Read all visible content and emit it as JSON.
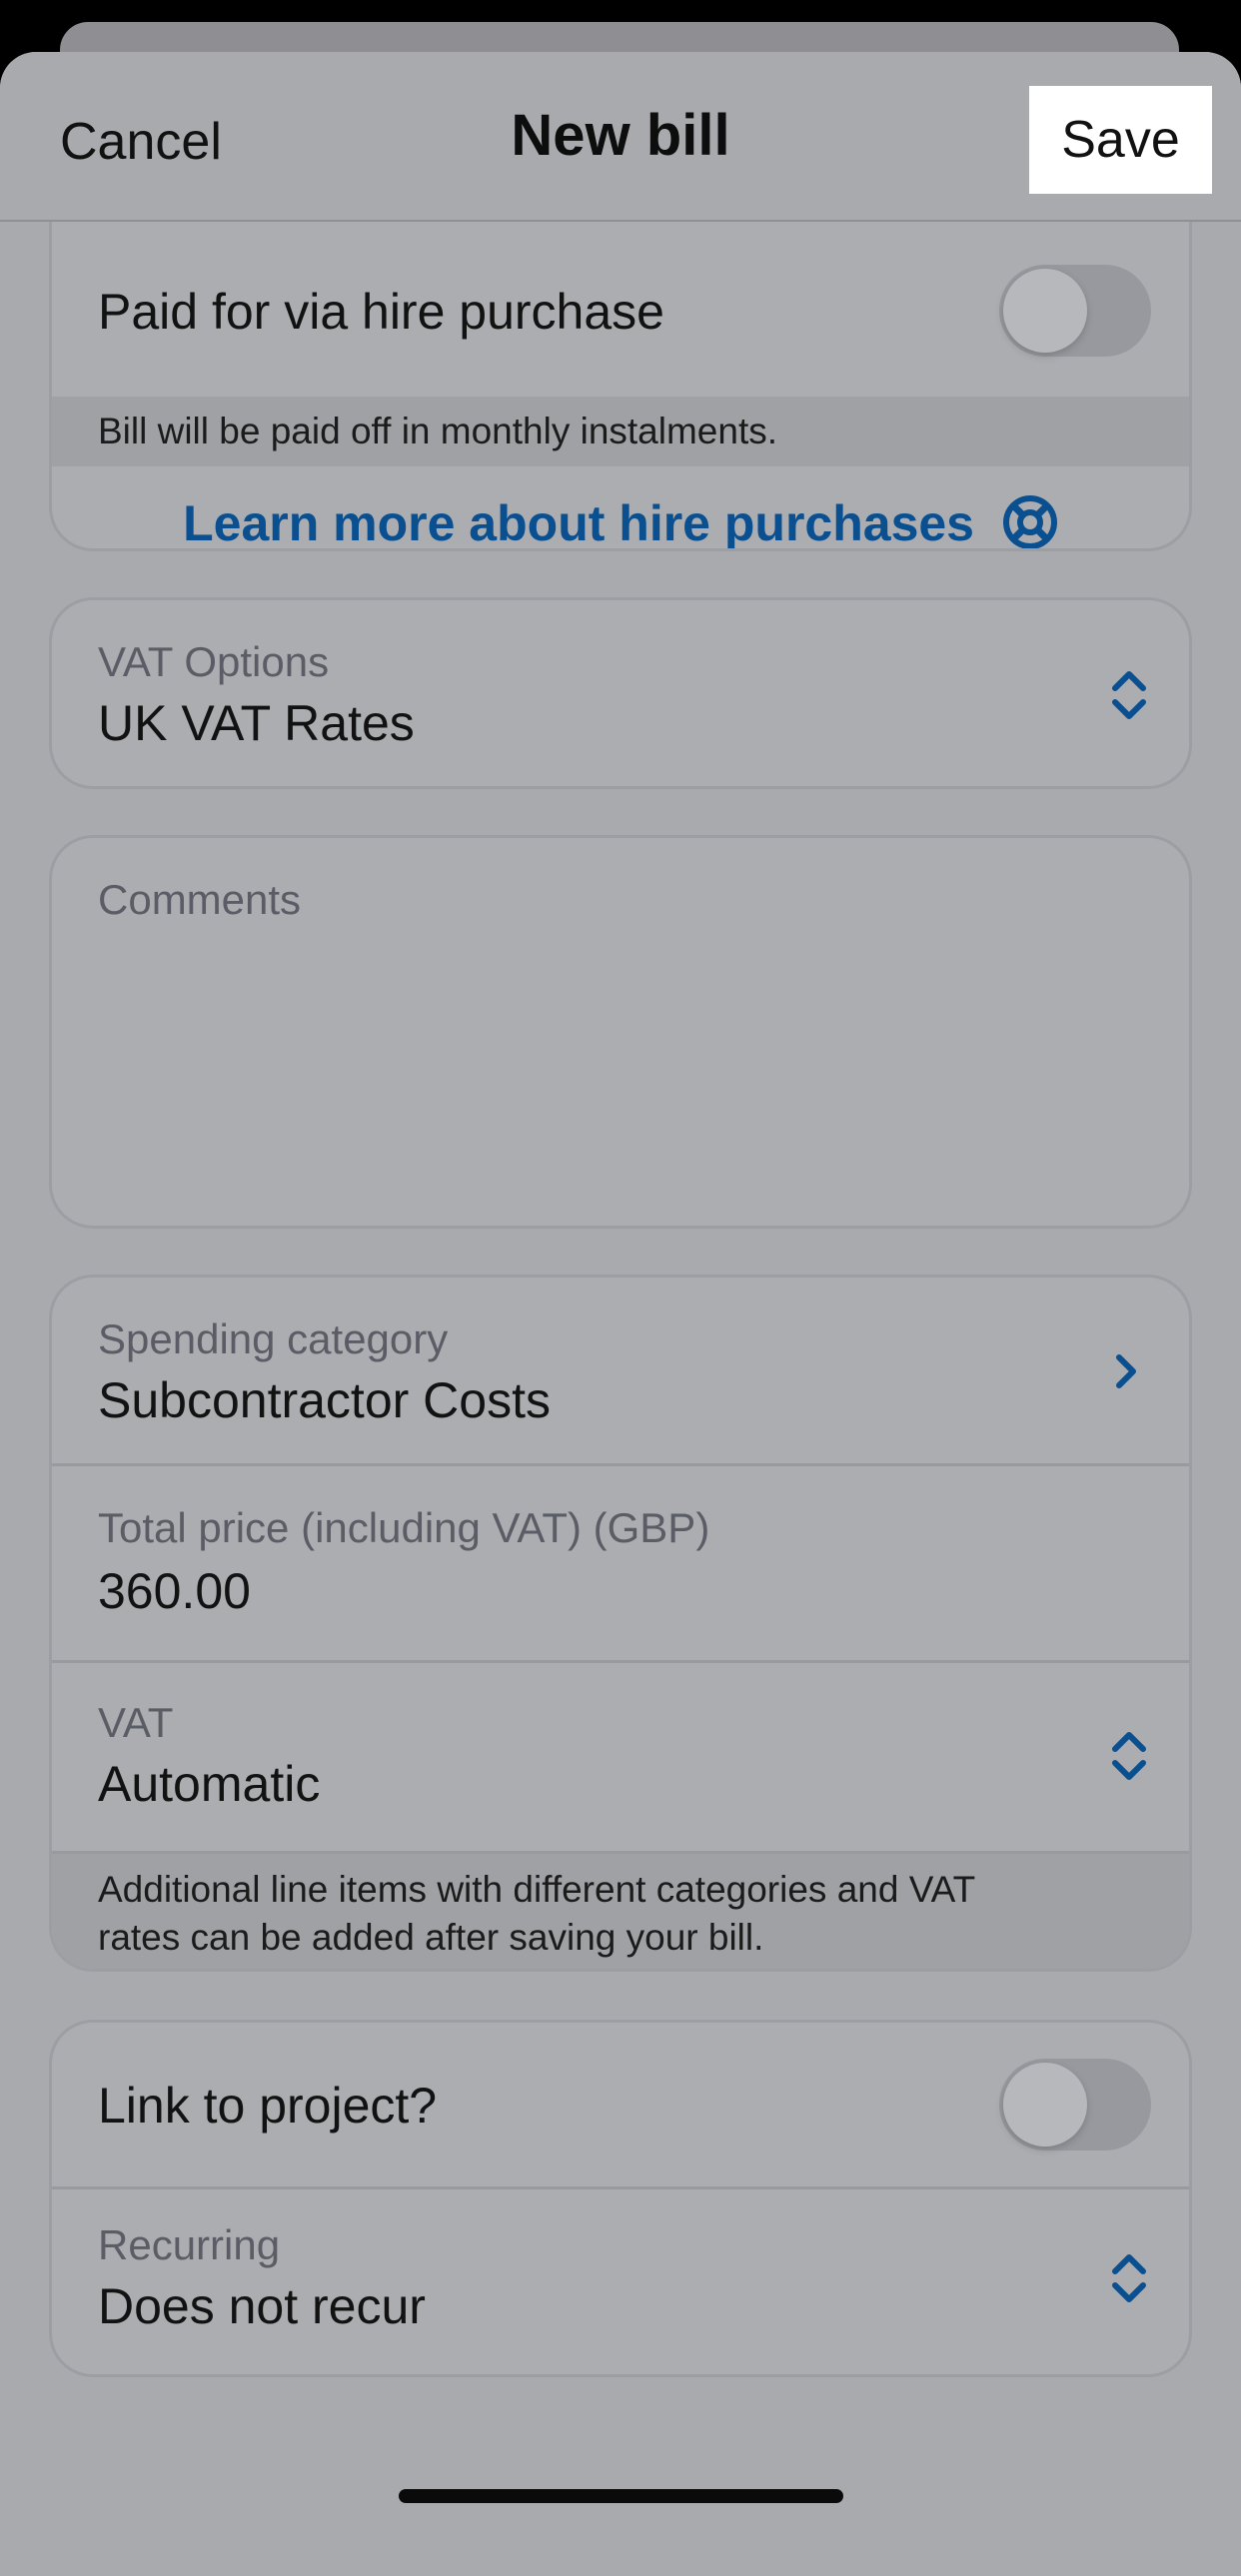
{
  "navbar": {
    "cancel_label": "Cancel",
    "title": "New bill",
    "save_label": "Save"
  },
  "hire_purchase": {
    "label": "Paid for via hire purchase",
    "toggle_on": false,
    "info": "Bill will be paid off in monthly instalments.",
    "link_label": "Learn more about hire purchases",
    "link_icon": "lifebuoy-icon"
  },
  "vat_options": {
    "label": "VAT Options",
    "value": "UK VAT Rates",
    "icon": "up-down-chevron-icon"
  },
  "comments": {
    "placeholder": "Comments",
    "value": ""
  },
  "line_item": {
    "category_label": "Spending category",
    "category_value": "Subcontractor Costs",
    "total_label": "Total price (including VAT) (GBP)",
    "total_value": "360.00",
    "vat_label": "VAT",
    "vat_value": "Automatic",
    "info_line1": "Additional line items with different categories and VAT",
    "info_line2": "rates can be added after saving your bill."
  },
  "project": {
    "label": "Link to project?",
    "toggle_on": false,
    "recurring_label": "Recurring",
    "recurring_value": "Does not recur"
  },
  "colors": {
    "accent": "#0a4f8f",
    "sheet_background": "#a9aaae"
  }
}
